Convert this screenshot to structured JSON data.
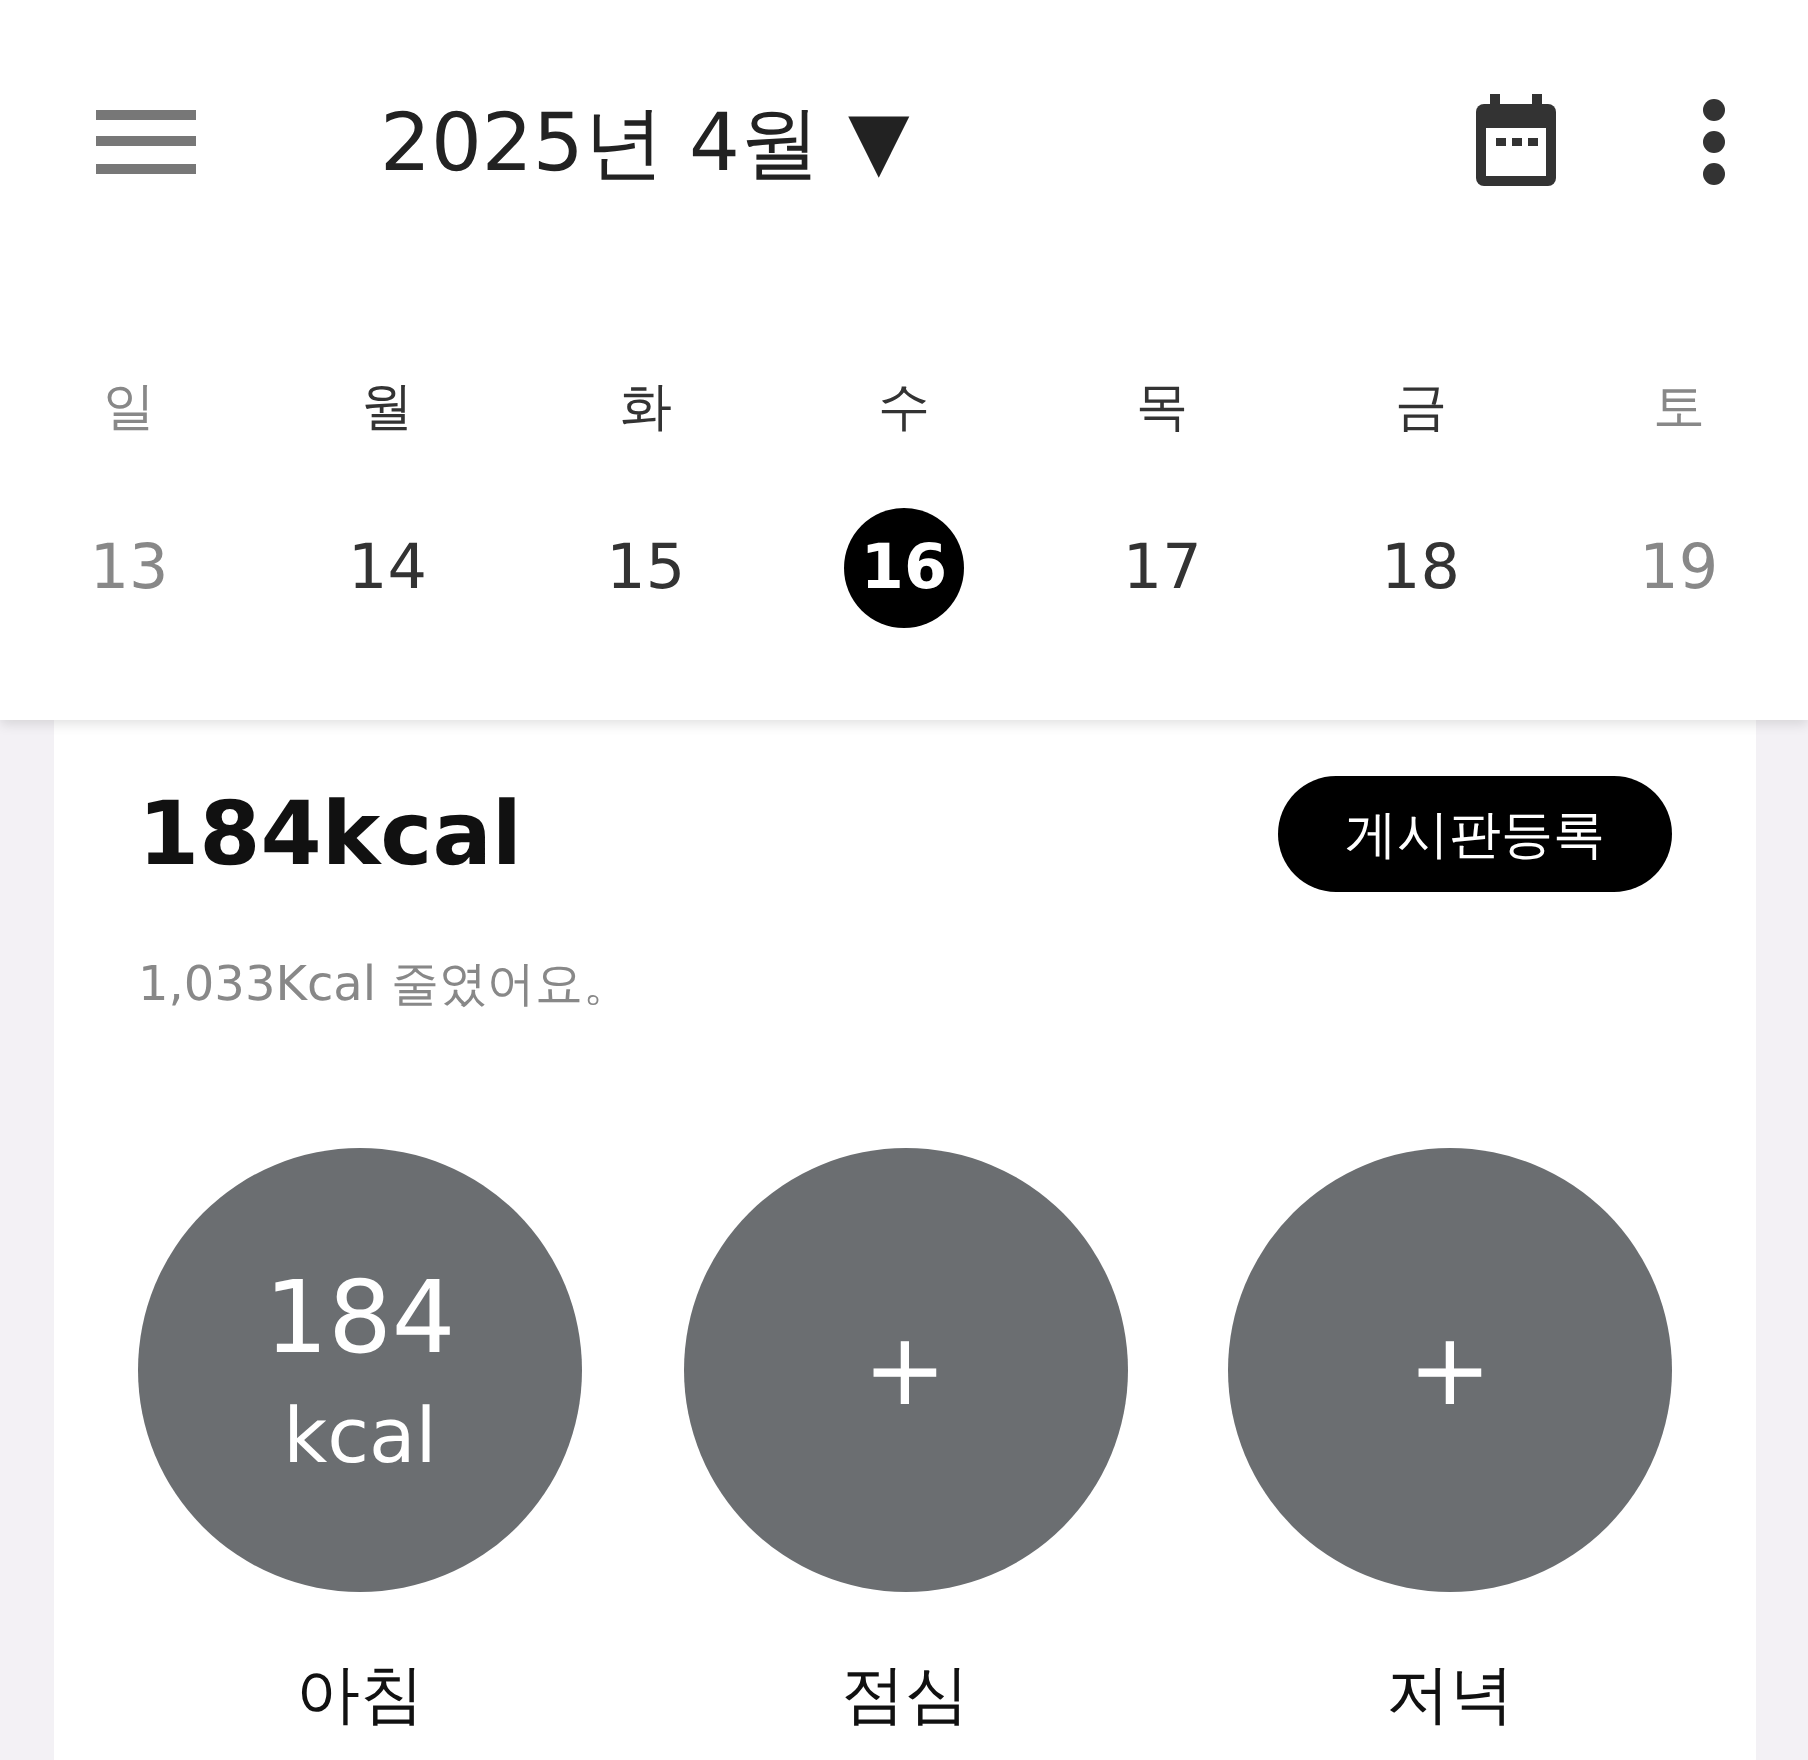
{
  "header": {
    "title": "2025년 4월",
    "dropdown": "▼"
  },
  "week": [
    {
      "weekday": "일",
      "day": "13",
      "weekend": true,
      "selected": false
    },
    {
      "weekday": "월",
      "day": "14",
      "weekend": false,
      "selected": false
    },
    {
      "weekday": "화",
      "day": "15",
      "weekend": false,
      "selected": false
    },
    {
      "weekday": "수",
      "day": "16",
      "weekend": false,
      "selected": true
    },
    {
      "weekday": "목",
      "day": "17",
      "weekend": false,
      "selected": false
    },
    {
      "weekday": "금",
      "day": "18",
      "weekend": false,
      "selected": false
    },
    {
      "weekday": "토",
      "day": "19",
      "weekend": true,
      "selected": false
    }
  ],
  "summary": {
    "total": "184kcal",
    "button": "게시판등록",
    "note": "1,033Kcal 줄였어요。"
  },
  "meals": [
    {
      "kind": "logged",
      "value": "184",
      "unit": "kcal",
      "label": "아침"
    },
    {
      "kind": "empty",
      "symbol": "+",
      "label": "점심"
    },
    {
      "kind": "empty",
      "symbol": "+",
      "label": "저녁"
    }
  ]
}
